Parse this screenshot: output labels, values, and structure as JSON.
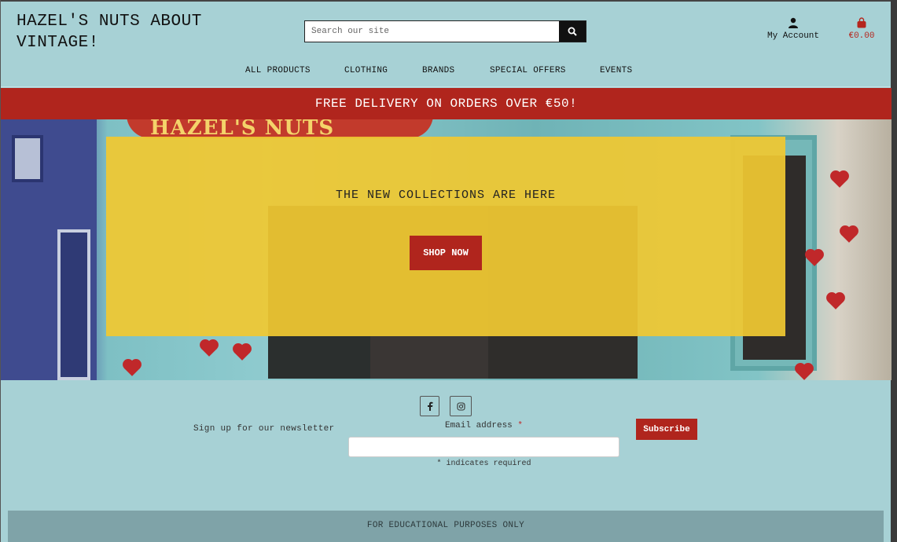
{
  "header": {
    "site_title": "HAZEL'S NUTS ABOUT VINTAGE!",
    "search_placeholder": "Search our site",
    "account_label": "My Account",
    "bag_total": "€0.00"
  },
  "nav": {
    "items": [
      "ALL PRODUCTS",
      "CLOTHING",
      "BRANDS",
      "SPECIAL OFFERS",
      "EVENTS"
    ]
  },
  "banner": {
    "text": "FREE DELIVERY ON ORDERS OVER €50!"
  },
  "hero": {
    "heading": "THE NEW COLLECTIONS ARE HERE",
    "button_label": "SHOP NOW",
    "storefront_sign": "HAZEL'S NUTS"
  },
  "footer": {
    "newsletter_label": "Sign up for our newsletter",
    "email_label": "Email address",
    "required_mark": "*",
    "required_note": "* indicates required",
    "subscribe_label": "Subscribe",
    "social_icons": [
      "facebook-icon",
      "instagram-icon"
    ],
    "edu_notice": "FOR EDUCATIONAL PURPOSES ONLY"
  },
  "colors": {
    "background": "#a7d1d5",
    "accent_red": "#b0251d",
    "hero_overlay": "#f0c832",
    "edu_bar": "#7fa3a8"
  }
}
